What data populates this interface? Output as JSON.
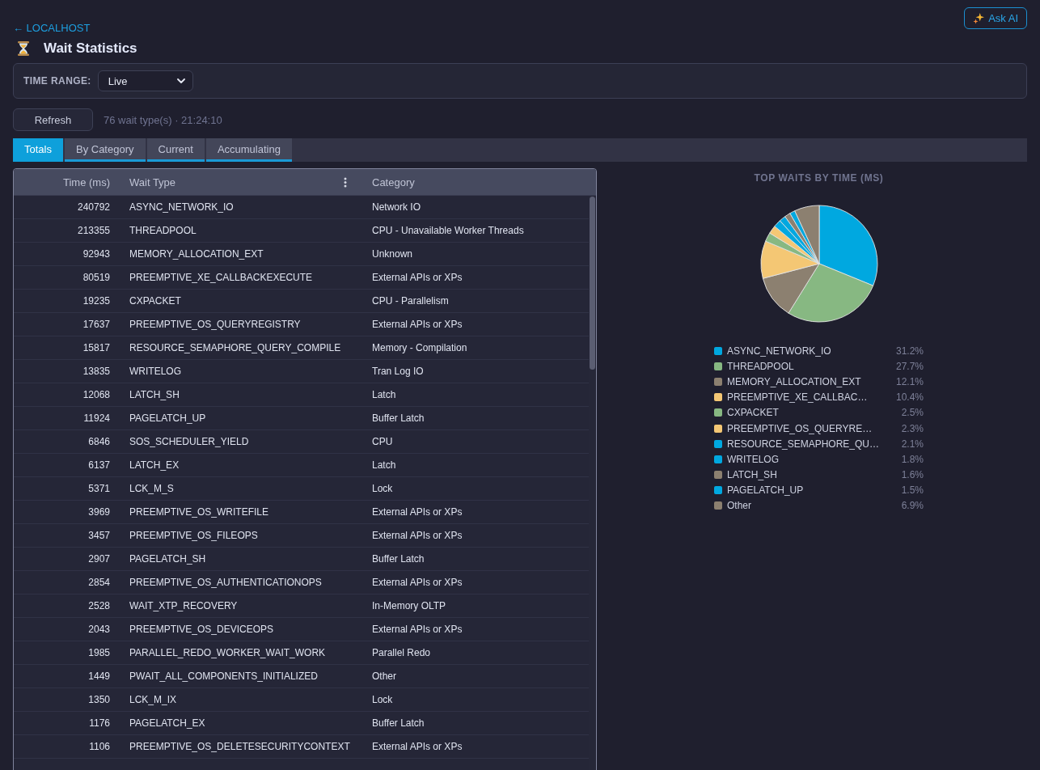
{
  "nav": {
    "back_link": "← LOCALHOST",
    "ask_ai_button": "Ask AI"
  },
  "page": {
    "title": "Wait Statistics"
  },
  "filters": {
    "time_range_label": "TIME RANGE:",
    "time_range_value": "Live"
  },
  "toolbar": {
    "refresh_button": "Refresh",
    "status": "76 wait type(s) · 21:24:10"
  },
  "tabs": [
    {
      "label": "Totals",
      "selected": true
    },
    {
      "label": "By Category",
      "selected": false
    },
    {
      "label": "Current",
      "selected": false
    },
    {
      "label": "Accumulating",
      "selected": false
    }
  ],
  "table": {
    "columns": [
      "Time (ms)",
      "Wait Type",
      "Category"
    ],
    "rows": [
      {
        "time": "240792",
        "wait_type": "ASYNC_NETWORK_IO",
        "category": "Network IO"
      },
      {
        "time": "213355",
        "wait_type": "THREADPOOL",
        "category": "CPU - Unavailable Worker Threads"
      },
      {
        "time": "92943",
        "wait_type": "MEMORY_ALLOCATION_EXT",
        "category": "Unknown"
      },
      {
        "time": "80519",
        "wait_type": "PREEMPTIVE_XE_CALLBACKEXECUTE",
        "category": "External APIs or XPs"
      },
      {
        "time": "19235",
        "wait_type": "CXPACKET",
        "category": "CPU - Parallelism"
      },
      {
        "time": "17637",
        "wait_type": "PREEMPTIVE_OS_QUERYREGISTRY",
        "category": "External APIs or XPs"
      },
      {
        "time": "15817",
        "wait_type": "RESOURCE_SEMAPHORE_QUERY_COMPILE",
        "category": "Memory - Compilation"
      },
      {
        "time": "13835",
        "wait_type": "WRITELOG",
        "category": "Tran Log IO"
      },
      {
        "time": "12068",
        "wait_type": "LATCH_SH",
        "category": "Latch"
      },
      {
        "time": "11924",
        "wait_type": "PAGELATCH_UP",
        "category": "Buffer Latch"
      },
      {
        "time": "6846",
        "wait_type": "SOS_SCHEDULER_YIELD",
        "category": "CPU"
      },
      {
        "time": "6137",
        "wait_type": "LATCH_EX",
        "category": "Latch"
      },
      {
        "time": "5371",
        "wait_type": "LCK_M_S",
        "category": "Lock"
      },
      {
        "time": "3969",
        "wait_type": "PREEMPTIVE_OS_WRITEFILE",
        "category": "External APIs or XPs"
      },
      {
        "time": "3457",
        "wait_type": "PREEMPTIVE_OS_FILEOPS",
        "category": "External APIs or XPs"
      },
      {
        "time": "2907",
        "wait_type": "PAGELATCH_SH",
        "category": "Buffer Latch"
      },
      {
        "time": "2854",
        "wait_type": "PREEMPTIVE_OS_AUTHENTICATIONOPS",
        "category": "External APIs or XPs"
      },
      {
        "time": "2528",
        "wait_type": "WAIT_XTP_RECOVERY",
        "category": "In-Memory OLTP"
      },
      {
        "time": "2043",
        "wait_type": "PREEMPTIVE_OS_DEVICEOPS",
        "category": "External APIs or XPs"
      },
      {
        "time": "1985",
        "wait_type": "PARALLEL_REDO_WORKER_WAIT_WORK",
        "category": "Parallel Redo"
      },
      {
        "time": "1449",
        "wait_type": "PWAIT_ALL_COMPONENTS_INITIALIZED",
        "category": "Other"
      },
      {
        "time": "1350",
        "wait_type": "LCK_M_IX",
        "category": "Lock"
      },
      {
        "time": "1176",
        "wait_type": "PAGELATCH_EX",
        "category": "Buffer Latch"
      },
      {
        "time": "1106",
        "wait_type": "PREEMPTIVE_OS_DELETESECURITYCONTEXT",
        "category": "External APIs or XPs"
      }
    ]
  },
  "chart": {
    "chart_data": {
      "type": "pie",
      "title": "TOP WAITS BY TIME (MS)",
      "categories": [
        "ASYNC_NETWORK_IO",
        "THREADPOOL",
        "MEMORY_ALLOCATION_EXT",
        "PREEMPTIVE_XE_CALLBAC…",
        "CXPACKET",
        "PREEMPTIVE_OS_QUERYRE…",
        "RESOURCE_SEMAPHORE_QU…",
        "WRITELOG",
        "LATCH_SH",
        "PAGELATCH_UP",
        "Other"
      ],
      "values": [
        31.2,
        27.7,
        12.1,
        10.4,
        2.5,
        2.3,
        2.1,
        1.8,
        1.6,
        1.5,
        6.9
      ],
      "legend": "bottom"
    },
    "legend_entries": [
      {
        "percent": "31.2%",
        "color": "#00a8e0"
      },
      {
        "percent": "27.7%",
        "color": "#87b882"
      },
      {
        "percent": "12.1%",
        "color": "#8c8070"
      },
      {
        "percent": "10.4%",
        "color": "#f4c774"
      },
      {
        "percent": "2.5%",
        "color": "#87b882"
      },
      {
        "percent": "2.3%",
        "color": "#f4c774"
      },
      {
        "percent": "2.1%",
        "color": "#00a8e0"
      },
      {
        "percent": "1.8%",
        "color": "#00a8e0"
      },
      {
        "percent": "1.6%",
        "color": "#8c8070"
      },
      {
        "percent": "1.5%",
        "color": "#00a8e0"
      },
      {
        "percent": "6.9%",
        "color": "#8c8070"
      }
    ]
  }
}
